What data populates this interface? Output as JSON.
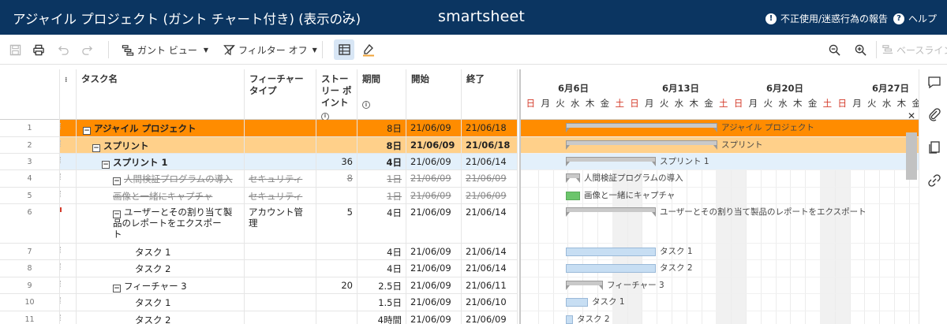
{
  "header": {
    "title": "アジャイル プロジェクト (ガント チャート付き) (表示のみ)",
    "menu_icon": "⋮",
    "brand": "smartsheet",
    "report_label": "不正使用/迷惑行為の報告",
    "help_label": "ヘルプ"
  },
  "toolbar": {
    "gantt_view_label": "ガント ビュー",
    "filter_label": "フィルター オフ",
    "baseline_label": "ベースライン"
  },
  "columns": {
    "task_name": "タスク名",
    "feature_type": "フィーチャー\nタイプ",
    "story_points": "ストー\nリー ポ\nイント",
    "duration": "期間",
    "start": "開始",
    "end": "終了"
  },
  "gantt_header": {
    "weeks": [
      "6月6日",
      "6月13日",
      "6月20日",
      "6月27日"
    ],
    "days": [
      "日",
      "月",
      "火",
      "水",
      "木",
      "金",
      "土",
      "日",
      "月",
      "火",
      "水",
      "木",
      "金",
      "土",
      "日",
      "月",
      "火",
      "水",
      "木",
      "金",
      "土",
      "日",
      "月",
      "火",
      "水",
      "木",
      "金"
    ]
  },
  "rows": [
    {
      "num": "1",
      "name": "アジャイル プロジェクト",
      "feature": "",
      "points": "",
      "duration": "8日",
      "start": "21/06/09",
      "end": "21/06/18",
      "gantt_label": "アジャイル プロジェクト"
    },
    {
      "num": "2",
      "name": "スプリント",
      "feature": "",
      "points": "",
      "duration": "8日",
      "start": "21/06/09",
      "end": "21/06/18",
      "gantt_label": "スプリント"
    },
    {
      "num": "3",
      "name": "スプリント 1",
      "feature": "",
      "points": "36",
      "duration": "4日",
      "start": "21/06/09",
      "end": "21/06/14",
      "gantt_label": "スプリント 1"
    },
    {
      "num": "4",
      "name": "人間検証プログラムの導入",
      "feature": "セキュリティ",
      "points": "8",
      "duration": "1日",
      "start": "21/06/09",
      "end": "21/06/09",
      "gantt_label": "人間検証プログラムの導入"
    },
    {
      "num": "5",
      "name": "画像と一緒にキャプチャ",
      "feature": "セキュリティ",
      "points": "",
      "duration": "1日",
      "start": "21/06/09",
      "end": "21/06/09",
      "gantt_label": "画像と一緒にキャプチャ"
    },
    {
      "num": "6",
      "name_lines": [
        "ユーザーとその割り当て製",
        "品のレポートをエクスポー",
        "ト"
      ],
      "feature_lines": [
        "アカウント管",
        "理"
      ],
      "points": "5",
      "duration": "4日",
      "start": "21/06/09",
      "end": "21/06/14",
      "gantt_label": "ユーザーとその割り当て製品のレポートをエクスポート"
    },
    {
      "num": "7",
      "name": "タスク 1",
      "feature": "",
      "points": "",
      "duration": "4日",
      "start": "21/06/09",
      "end": "21/06/14",
      "gantt_label": "タスク 1"
    },
    {
      "num": "8",
      "name": "タスク 2",
      "feature": "",
      "points": "",
      "duration": "4日",
      "start": "21/06/09",
      "end": "21/06/14",
      "gantt_label": "タスク 2"
    },
    {
      "num": "9",
      "name": "フィーチャー 3",
      "feature": "",
      "points": "20",
      "duration": "2.5日",
      "start": "21/06/09",
      "end": "21/06/11",
      "gantt_label": "フィーチャー 3"
    },
    {
      "num": "10",
      "name": "タスク 1",
      "feature": "",
      "points": "",
      "duration": "1.5日",
      "start": "21/06/09",
      "end": "21/06/10",
      "gantt_label": "タスク 1"
    },
    {
      "num": "11",
      "name": "タスク 2",
      "feature": "",
      "points": "",
      "duration": "4時間",
      "start": "21/06/09",
      "end": "21/06/09",
      "gantt_label": "タスク 2"
    }
  ],
  "colors": {
    "header_bg": "#0b3561",
    "row_level1": "#ff8c00",
    "row_level2": "#ffd08a",
    "row_level3": "#e3f0fb",
    "weekend_red": "#d43a2a",
    "task_bar": "#c7def3",
    "milestone_bar": "#6cc56c"
  }
}
